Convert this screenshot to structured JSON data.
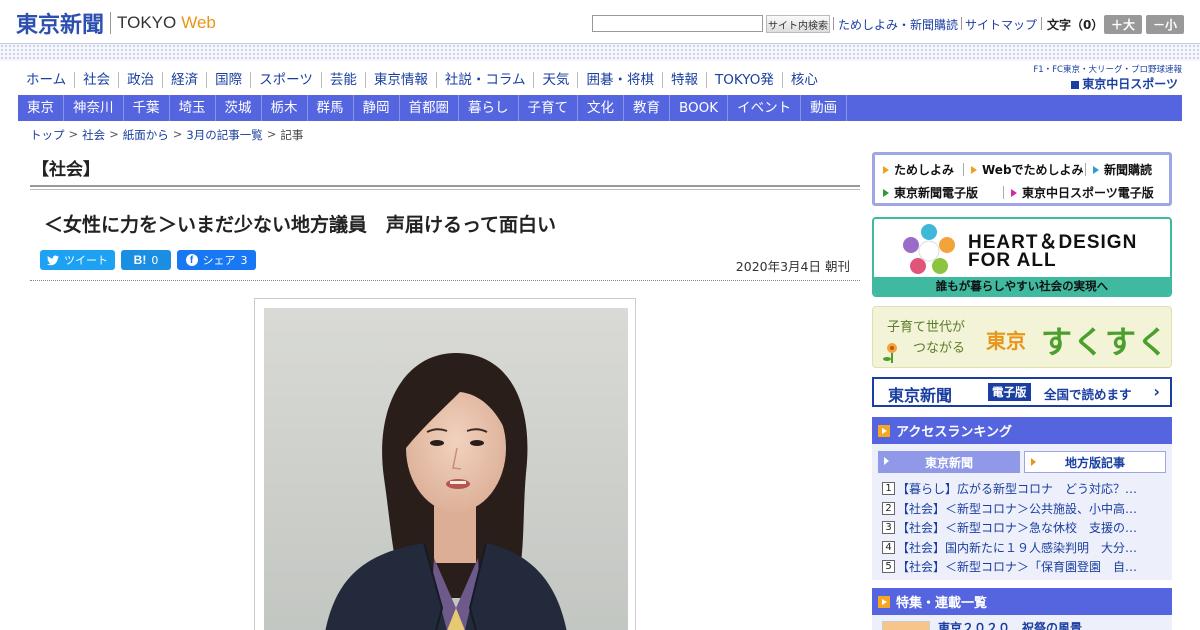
{
  "header": {
    "logo_jp": "東京新聞",
    "logo_en": "TOKYO",
    "logo_web": "Web",
    "search_placeholder": "",
    "search_button": "サイト内検索",
    "links": [
      "ためしよみ・新聞購読",
      "サイトマップ"
    ],
    "font_size_label": "文字（0）",
    "font_larger": "＋大",
    "font_smaller": "－小"
  },
  "global_nav": [
    "ホーム",
    "社会",
    "政治",
    "経済",
    "国際",
    "スポーツ",
    "芸能",
    "東京情報",
    "社説・コラム",
    "天気",
    "囲碁・将棋",
    "特報",
    "TOKYO発",
    "核心"
  ],
  "chunichi": {
    "small": "F1・FC東京・大リーグ・プロ野球速報",
    "big": "東京中日スポーツ"
  },
  "region_nav": [
    "東京",
    "神奈川",
    "千葉",
    "埼玉",
    "茨城",
    "栃木",
    "群馬",
    "静岡",
    "首都圏",
    "暮らし",
    "子育て",
    "文化",
    "教育",
    "BOOK",
    "イベント",
    "動画"
  ],
  "breadcrumb": [
    "トップ",
    "社会",
    "紙面から",
    "3月の記事一覧",
    "記事"
  ],
  "article": {
    "section": "【社会】",
    "title": "＜女性に力を＞いまだ少ない地方議員　声届けるって面白い",
    "tweet_label": "ツイート",
    "hatena_label": "B!",
    "hatena_count": "0",
    "share_label": "シェア",
    "share_count": "3",
    "date": "2020年3月4日 朝刊"
  },
  "sidebar": {
    "sub_links": [
      "ためしよみ",
      "Webでためしよみ",
      "新聞購読",
      "東京新聞電子版",
      "東京中日スポーツ電子版"
    ],
    "heart_line1": "HEART＆DESIGN",
    "heart_line2": "FOR ALL",
    "heart_caption": "誰もが暮らしやすい社会の実現へ",
    "suku_line1": "子育て世代が",
    "suku_line2": "つながる",
    "suku_tokyo": "東京",
    "suku_main": "すくすく",
    "digital_logo": "東京新聞",
    "digital_badge": "電子版",
    "digital_text": "全国で読めます",
    "ranking_title": "アクセスランキング",
    "ranking_tab_tokyo": "東京新聞",
    "ranking_tab_local": "地方版記事",
    "ranking": [
      {
        "num": "1",
        "text": "【暮らし】広がる新型コロナ　どう対応？…"
      },
      {
        "num": "2",
        "text": "【社会】＜新型コロナ＞公共施設、小中高…"
      },
      {
        "num": "3",
        "text": "【社会】＜新型コロナ＞急な休校　支援の…"
      },
      {
        "num": "4",
        "text": "【社会】国内新たに１９人感染判明　大分…"
      },
      {
        "num": "5",
        "text": "【社会】＜新型コロナ＞「保育園登園　自…"
      }
    ],
    "feature_title": "特集・連載一覧",
    "feature_item": "東京２０２０　祝祭の風景"
  },
  "colors": {
    "brand_blue": "#2d4fb0",
    "nav_bar": "#5565e0",
    "accent_orange": "#e8961a",
    "link": "#1a3fa0"
  }
}
